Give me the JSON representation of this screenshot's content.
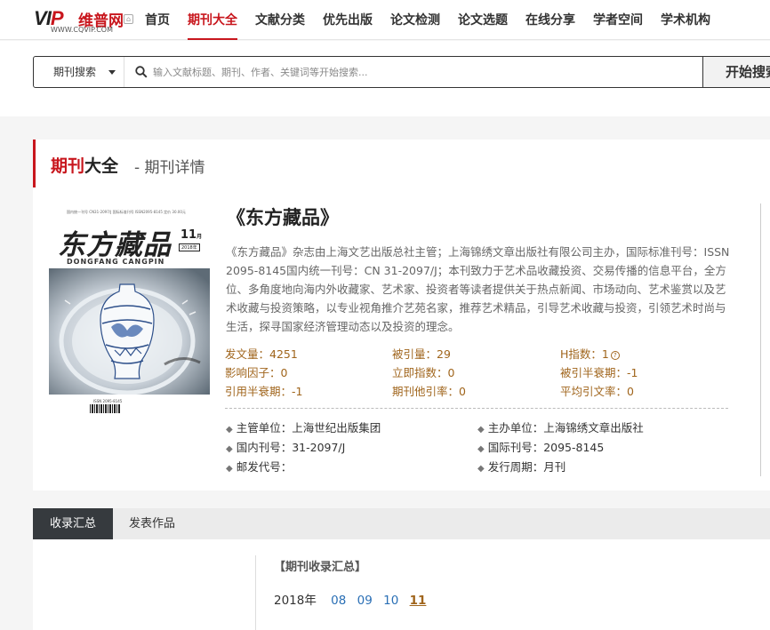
{
  "nav": {
    "logo_mark_v": "V",
    "logo_mark_i": "I",
    "logo_mark_p": "P",
    "logo_cn": "维普网",
    "logo_url": "WWW.CQVIP.COM",
    "items": [
      {
        "label": "首页"
      },
      {
        "label": "期刊大全"
      },
      {
        "label": "文献分类"
      },
      {
        "label": "优先出版"
      },
      {
        "label": "论文检测"
      },
      {
        "label": "论文选题"
      },
      {
        "label": "在线分享"
      },
      {
        "label": "学者空间"
      },
      {
        "label": "学术机构"
      }
    ],
    "active_index": 1
  },
  "search": {
    "type_label": "期刊搜索",
    "placeholder": "输入文献标题、期刊、作者、关键词等开始搜索...",
    "button_label": "开始搜索"
  },
  "section": {
    "title_red": "期刊",
    "title_black": "大全",
    "subtitle": "- 期刊详情"
  },
  "cover": {
    "masthead_small": "国内统一刊号 CN31-2097/J  国际标准刊号 ISSN2095-8145  定价 30.00元",
    "cn_title": "东方藏品",
    "issue": "11",
    "issue_suffix": "月",
    "year": "2018年",
    "pinyin": "DONGFANG CANGPIN",
    "isbn": "ISSN 2095-8145"
  },
  "journal": {
    "title": "《东方藏品》",
    "description": "《东方藏品》杂志由上海文艺出版总社主管；上海锦绣文章出版社有限公司主办，国际标准刊号：ISSN 2095-8145国内统一刊号：CN 31-2097/J；本刊致力于艺术品收藏投资、交易传播的信息平台，全方位、多角度地向海内外收藏家、艺术家、投资者等读者提供关于热点新闻、市场动向、艺术鉴赏以及艺术收藏与投资策略，以专业视角推介艺苑名家，推荐艺术精品，引导艺术收藏与投资，引领艺术时尚与生活，探寻国家经济管理动态以及投资的理念。",
    "stats": [
      {
        "label": "发文量：4251"
      },
      {
        "label": "被引量：29"
      },
      {
        "label": "H指数：1"
      },
      {
        "label": "影响因子：0"
      },
      {
        "label": "立即指数：0"
      },
      {
        "label": "被引半衰期：-1"
      },
      {
        "label": "引用半衰期：-1"
      },
      {
        "label": "期刊他引率：0"
      },
      {
        "label": "平均引文率：0"
      }
    ],
    "help_icon": "?",
    "meta": [
      {
        "label": "主管单位：上海世纪出版集团"
      },
      {
        "label": "主办单位：上海锦绣文章出版社"
      },
      {
        "label": "国内刊号：31-2097/J"
      },
      {
        "label": "国际刊号：2095-8145"
      },
      {
        "label": "邮发代号："
      },
      {
        "label": "发行周期：月刊"
      }
    ],
    "bullet": "◆"
  },
  "tabs": [
    {
      "label": "收录汇总"
    },
    {
      "label": "发表作品"
    }
  ],
  "summary": {
    "title": "【期刊收录汇总】",
    "year": "2018年",
    "months": [
      "08",
      "09",
      "10",
      "11"
    ],
    "current_month": "11"
  },
  "colors": {
    "brand_red": "#c8161d",
    "stat_brown": "#a0651c",
    "link_blue": "#2a6fb5",
    "tab_dark": "#363a3e"
  }
}
